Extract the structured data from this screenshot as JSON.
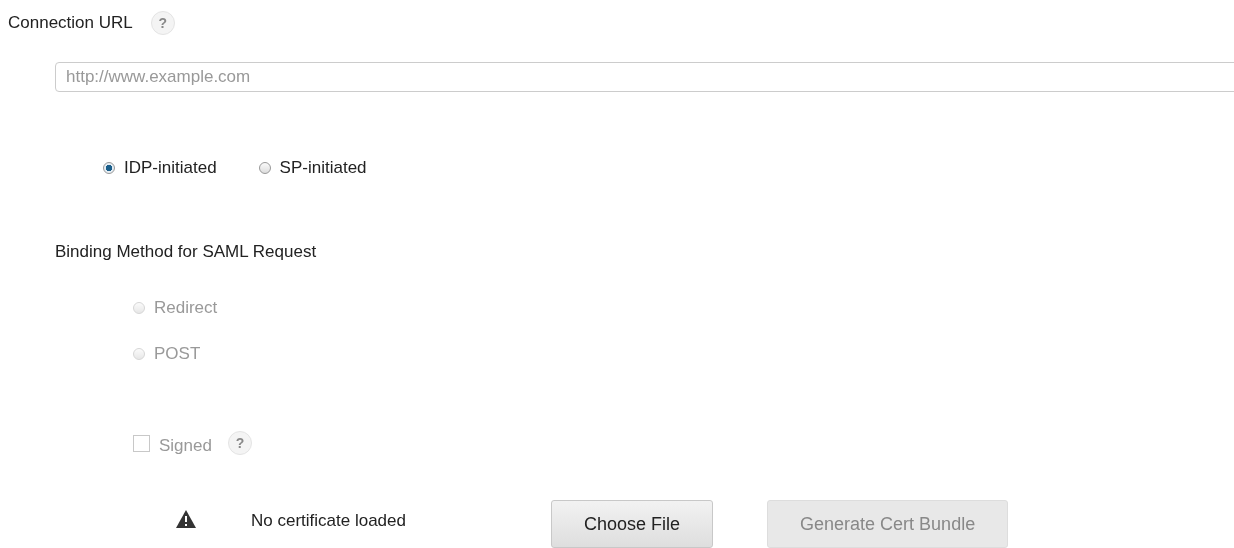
{
  "connection_url": {
    "label": "Connection URL",
    "help": "?",
    "placeholder": "http://www.example.com"
  },
  "initiation": [
    {
      "label": "IDP-initiated",
      "selected": true,
      "disabled": false
    },
    {
      "label": "SP-initiated",
      "selected": false,
      "disabled": false
    }
  ],
  "binding": {
    "label": "Binding Method for SAML Request",
    "options": [
      {
        "label": "Redirect",
        "selected": false,
        "disabled": true
      },
      {
        "label": "POST",
        "selected": false,
        "disabled": true
      }
    ]
  },
  "signed": {
    "label": "Signed",
    "checked": false,
    "disabled": true,
    "help": "?"
  },
  "certificate": {
    "status": "No certificate loaded",
    "buttons": [
      {
        "label": "Choose File",
        "disabled": false
      },
      {
        "label": "Generate Cert Bundle",
        "disabled": true
      }
    ]
  }
}
